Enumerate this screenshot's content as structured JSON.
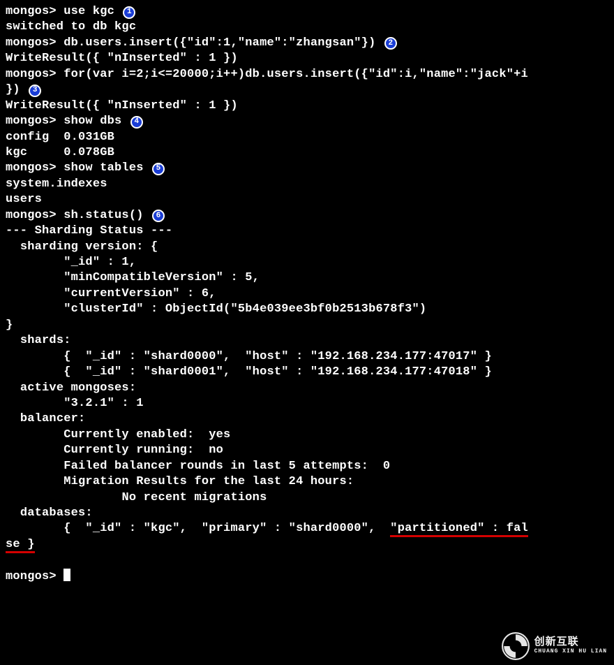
{
  "prompt": "mongos> ",
  "commands": {
    "c1": "use kgc",
    "c2": "db.users.insert({\"id\":1,\"name\":\"zhangsan\"})",
    "c3a": "for(var i=2;i<=20000;i++)db.users.insert({\"id\":i,\"name\":\"jack\"+i",
    "c3b": "})",
    "c4": "show dbs",
    "c5": "show tables",
    "c6": "sh.status()"
  },
  "responses": {
    "switched": "switched to db kgc",
    "write1": "WriteResult({ \"nInserted\" : 1 })",
    "write2": "WriteResult({ \"nInserted\" : 1 })",
    "dbs": [
      "config  0.031GB",
      "kgc     0.078GB"
    ],
    "tables": [
      "system.indexes",
      "users"
    ],
    "status": {
      "head": "--- Sharding Status --- ",
      "ver_open": "  sharding version: {",
      "ver_id": "        \"_id\" : 1,",
      "ver_min": "        \"minCompatibleVersion\" : 5,",
      "ver_cur": "        \"currentVersion\" : 6,",
      "ver_cid": "        \"clusterId\" : ObjectId(\"5b4e039ee3bf0b2513b678f3\")",
      "close": "}",
      "shards_h": "  shards:",
      "shard0": "        {  \"_id\" : \"shard0000\",  \"host\" : \"192.168.234.177:47017\" }",
      "shard1": "        {  \"_id\" : \"shard0001\",  \"host\" : \"192.168.234.177:47018\" }",
      "active_h": "  active mongoses:",
      "active_v": "        \"3.2.1\" : 1",
      "bal_h": "  balancer:",
      "bal_en": "        Currently enabled:  yes",
      "bal_run": "        Currently running:  no",
      "bal_fail": "        Failed balancer rounds in last 5 attempts:  0",
      "bal_mig": "        Migration Results for the last 24 hours: ",
      "bal_none": "                No recent migrations",
      "db_h": "  databases:",
      "db_line_a": "        {  \"_id\" : \"kgc\",  \"primary\" : \"shard0000\",  ",
      "db_line_b": "\"partitioned\" : fal",
      "db_line_c": "se }"
    }
  },
  "badges": {
    "b1": "1",
    "b2": "2",
    "b3": "3",
    "b4": "4",
    "b5": "5",
    "b6": "6"
  },
  "watermark": {
    "cn": "创新互联",
    "en": "CHUANG XIN HU LIAN"
  }
}
